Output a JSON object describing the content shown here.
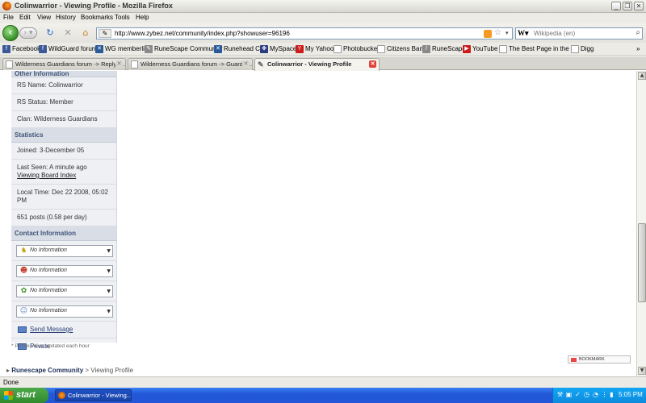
{
  "window": {
    "title": "Colinwarrior - Viewing Profile - Mozilla Firefox"
  },
  "menu": [
    "File",
    "Edit",
    "View",
    "History",
    "Bookmarks",
    "Tools",
    "Help"
  ],
  "nav": {
    "url": "http://www.zybez.net/community/index.php?showuser=96196",
    "search_placeholder": "Wikipedia (en)"
  },
  "bookmarks": [
    {
      "label": "Facebook",
      "icon": "facebook-icon",
      "color": "#3b5998"
    },
    {
      "label": "WildGuard forums",
      "icon": "facebook-icon",
      "color": "#3b5998"
    },
    {
      "label": "WG memberlist",
      "icon": "x-icon",
      "color": "#2a5a9a"
    },
    {
      "label": "RuneScape Communtiy",
      "icon": "pencil-icon",
      "color": "#6b6b6b"
    },
    {
      "label": "Runehead CD",
      "icon": "x-icon",
      "color": "#2a5a9a"
    },
    {
      "label": "MySpace",
      "icon": "myspace-icon",
      "color": "#2c3e80"
    },
    {
      "label": "My Yahoo",
      "icon": "yahoo-icon",
      "color": "#cc1c1c"
    },
    {
      "label": "Photobucket",
      "icon": "page-icon",
      "color": "#9aa"
    },
    {
      "label": "Citizens Bank",
      "icon": "page-icon",
      "color": "#9aa"
    },
    {
      "label": "RuneScape",
      "icon": "sword-icon",
      "color": "#6b6b6b"
    },
    {
      "label": "YouTube",
      "icon": "youtube-icon",
      "color": "#cc1c1c"
    },
    {
      "label": "The Best Page in the ...",
      "icon": "page-icon",
      "color": "#9aa"
    },
    {
      "label": "Digg",
      "icon": "page-icon",
      "color": "#9aa"
    }
  ],
  "tabs": [
    {
      "label": "Wilderness Guardians forum -> Replyin...",
      "active": false
    },
    {
      "label": "Wilderness Guardians forum -> Guardia...",
      "active": false
    },
    {
      "label": "Colinwarrior - Viewing Profile",
      "active": true
    }
  ],
  "profile": {
    "other_info_header": "Other Information",
    "rs_name": "RS Name: Colinwarrior",
    "rs_status": "RS Status: Member",
    "clan": "Clan: Wilderness Guardians",
    "statistics_header": "Statistics",
    "joined": "Joined: 3-December 05",
    "last_seen": "Last Seen: A minute ago",
    "last_seen_link": "Viewing Board Index",
    "local_time": "Local Time: Dec 22 2008, 05:02 PM",
    "posts": "651 posts (0.58 per day)",
    "contact_header": "Contact Information",
    "contacts": [
      {
        "icon": "aim-icon",
        "value": "No Information"
      },
      {
        "icon": "msn-icon",
        "value": "No Information"
      },
      {
        "icon": "icq-icon",
        "value": "No Information"
      },
      {
        "icon": "yahoo-messenger-icon",
        "value": "No Information"
      }
    ],
    "send_message": "Send Message",
    "private": "Private",
    "note": "* Profile views updated each hour"
  },
  "bookmark_button": "BOOKMARK",
  "breadcrumb": {
    "root": "Runescape Community",
    "separator": " > ",
    "current": "Viewing Profile"
  },
  "status": "Done",
  "taskbar": {
    "start": "start",
    "item": "Colinwarrior - Viewing...",
    "clock": "5:05 PM"
  }
}
